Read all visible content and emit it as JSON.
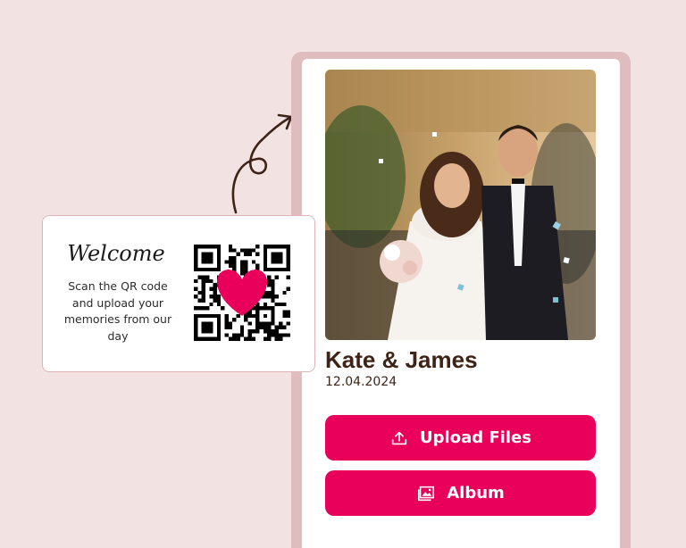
{
  "card": {
    "welcome": "Welcome",
    "instructions": "Scan the QR code and upload your memories from our day"
  },
  "event": {
    "couple_name": "Kate & James",
    "date": "12.04.2024"
  },
  "buttons": {
    "upload_label": "Upload Files",
    "upload_icon": "upload-icon",
    "album_label": "Album",
    "album_icon": "image-gallery-icon"
  },
  "colors": {
    "background": "#f3e2e2",
    "phone_frame": "#dfbcbe",
    "accent": "#e8005a",
    "heart": "#e8005a",
    "title_text": "#3d2416"
  }
}
